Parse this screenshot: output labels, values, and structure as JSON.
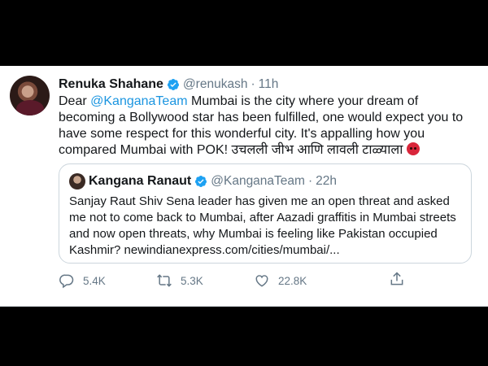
{
  "tweet": {
    "author_name": "Renuka Shahane",
    "handle": "@renukash",
    "separator": "·",
    "time": "11h",
    "text_pre": "Dear ",
    "mention": "@KanganaTeam",
    "text_post": " Mumbai is the city where your dream of becoming a Bollywood star has been fulfilled, one would expect you to have some respect for this wonderful city. It's appalling how you compared Mumbai with POK! उचलली जीभ आणि लावली टाळ्याला ",
    "emoji": "angry-face-icon"
  },
  "quoted": {
    "author_name": "Kangana Ranaut",
    "handle": "@KanganaTeam",
    "separator": "·",
    "time": "22h",
    "text": "Sanjay Raut Shiv Sena leader has given me an open threat and asked me not to come back to Mumbai, after Aazadi graffitis in Mumbai streets and now open threats, why Mumbai is feeling like Pakistan occupied Kashmir? newindianexpress.com/cities/mumbai/..."
  },
  "actions": {
    "replies": "5.4K",
    "retweets": "5.3K",
    "likes": "22.8K"
  },
  "colors": {
    "mention": "#1b95e0",
    "verified": "#1da1f2",
    "muted": "#657786"
  }
}
